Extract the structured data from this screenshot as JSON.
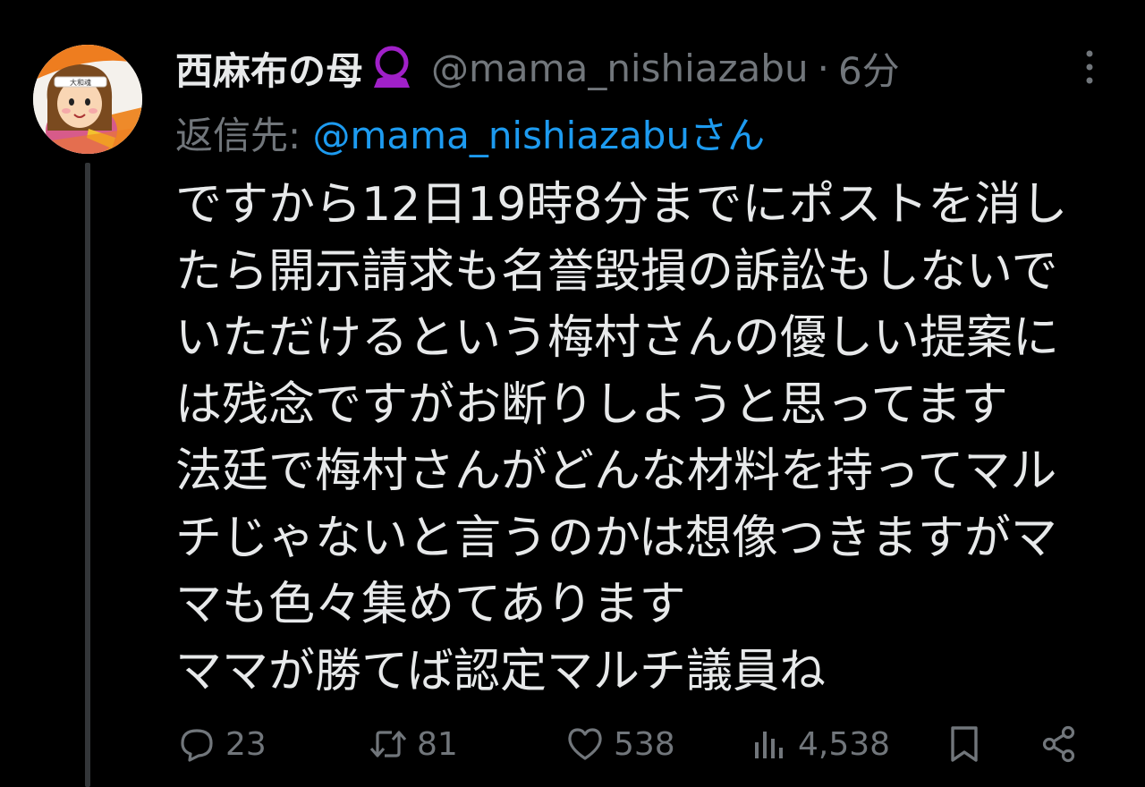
{
  "tweet": {
    "display_name": "西麻布の母",
    "handle": "@mama_nishiazabu",
    "separator": "·",
    "time": "6分",
    "reply_label": "返信先: ",
    "reply_target": "@mama_nishiazabuさん",
    "text": "ですから12日19時8分までにポストを消し\nたら開示請求も名誉毀損の訴訟もしないで\nいただけるという梅村さんの優しい提案に\nは残念ですがお断りしようと思ってます\n法廷で梅村さんがどんな材料を持ってマル\nチじゃないと言うのかは想像つきますがマ\nマも色々集めてあります\nママが勝てば認定マルチ議員ね",
    "avatar_headband_text": "大和魂"
  },
  "actions": {
    "reply_count": "23",
    "repost_count": "81",
    "like_count": "538",
    "views_count": "4,538"
  },
  "icons": {
    "badge": "crystal-ball-icon",
    "more": "more-vertical-icon",
    "reply": "reply-bubble-icon",
    "repost": "repost-icon",
    "like": "heart-icon",
    "views": "views-bar-chart-icon",
    "bookmark": "bookmark-icon",
    "share": "share-icon"
  },
  "colors": {
    "background": "#000000",
    "text": "#e7e9ea",
    "muted": "#71767b",
    "link": "#1d9bf0",
    "badge": "#a020c8",
    "thread_line": "#333639"
  }
}
